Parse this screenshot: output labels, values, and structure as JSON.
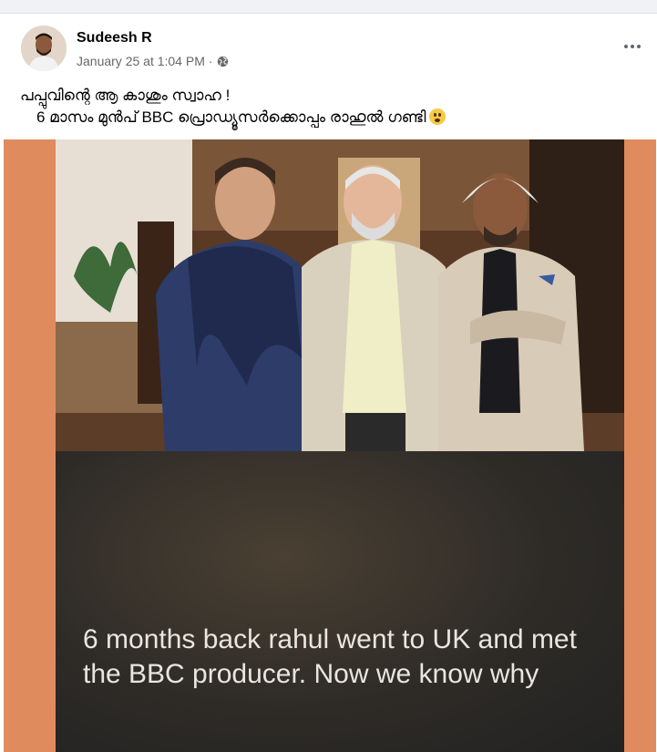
{
  "post": {
    "author": "Sudeesh R",
    "timestamp": "January 25 at 1:04 PM",
    "separator": "·",
    "audience_icon": "globe-icon",
    "more_icon": "more-options-icon",
    "text_line1": "പപ്പുവിന്റെ ആ കാശും സ്വാഹ !",
    "text_line2": "6 മാസം മുൻപ് BBC പ്രൊഡ്യൂസർക്കൊപ്പം രാഹുൽ ഗണ്ടി",
    "emoji": "flushed-face-emoji"
  },
  "image": {
    "caption": "6 months back rahul went to UK and met the BBC producer. Now we know why",
    "colors": {
      "frame": "#e08b5e",
      "caption_bg": "#2e2b27",
      "caption_text": "#e9e6df"
    }
  }
}
